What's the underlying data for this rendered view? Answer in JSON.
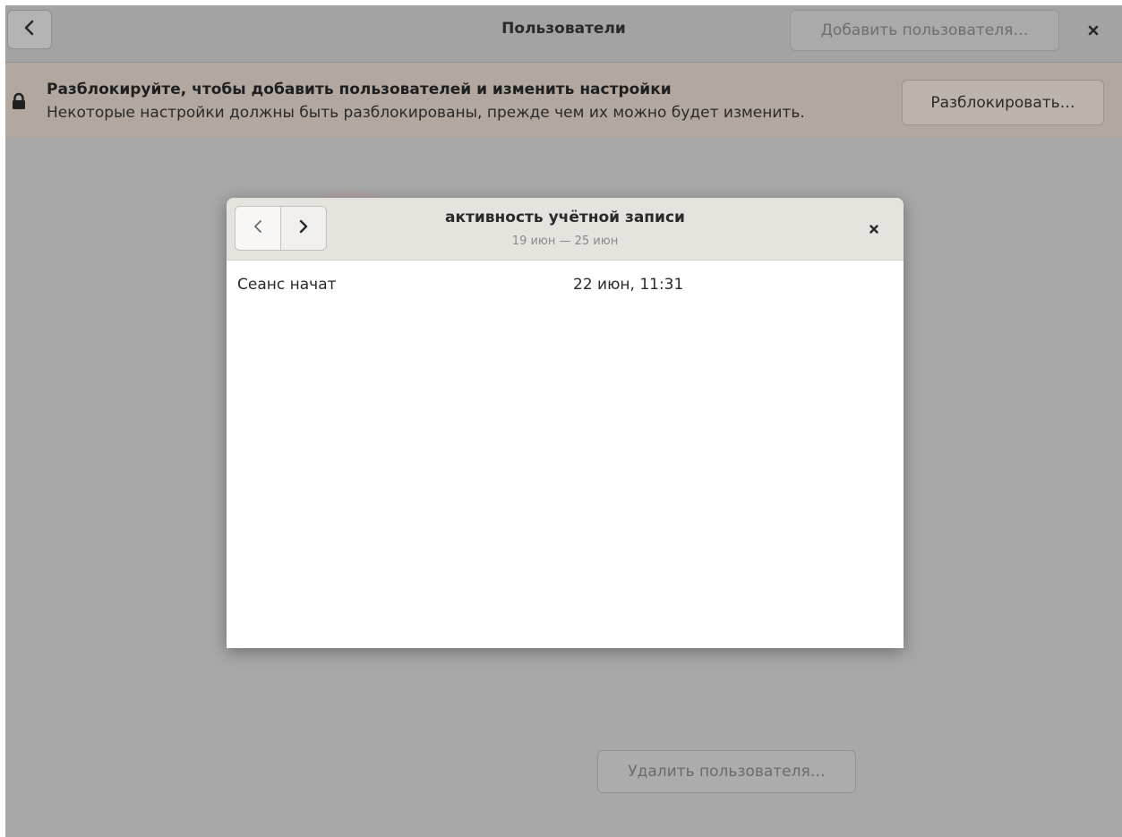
{
  "header": {
    "title": "Пользователи",
    "add_user_label": "Добавить пользователя…",
    "back_icon": "chevron-left-icon",
    "close_icon": "close-icon"
  },
  "infobar": {
    "title": "Разблокируйте, чтобы добавить пользователей и изменить настройки",
    "subtitle": "Некоторые настройки должны быть разблокированы, прежде чем их можно будет изменить.",
    "unlock_label": "Разблокировать…",
    "icon": "lock-icon"
  },
  "dialog": {
    "title": "активность учётной записи",
    "subtitle": "19 июн — 25 июн",
    "prev_icon": "chevron-left-icon",
    "next_icon": "chevron-right-icon",
    "close_icon": "close-icon",
    "rows": [
      {
        "event": "Сеанс начат",
        "time": "22 июн, 11:31"
      }
    ]
  },
  "footer": {
    "delete_user_label": "Удалить пользователя…"
  },
  "colors": {
    "overlay_bg": "#a8a8a8",
    "infobar_bg": "#b2a8a0",
    "dialog_header_bg": "#e6e2de"
  }
}
